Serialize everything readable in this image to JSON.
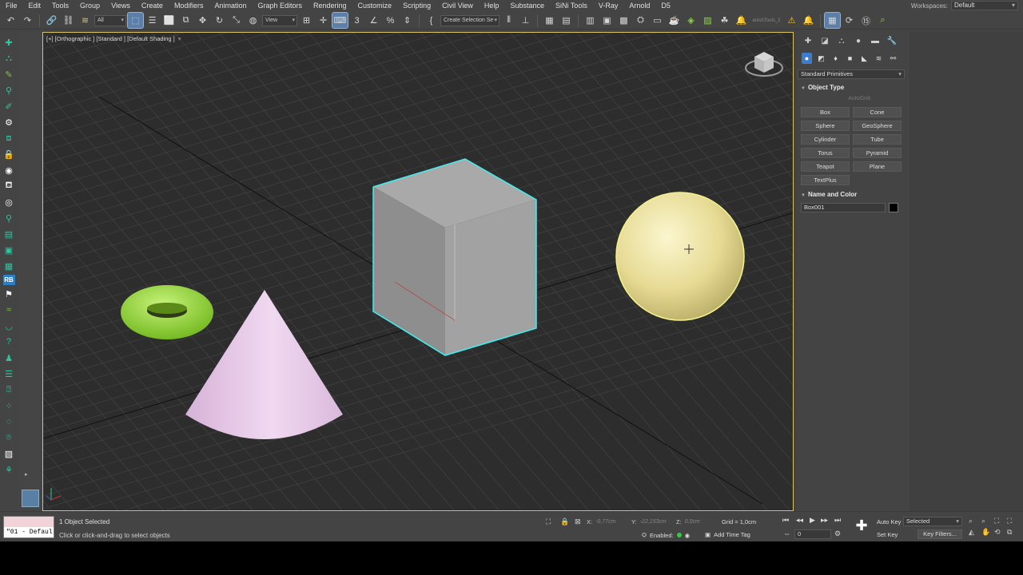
{
  "menubar": {
    "items": [
      "File",
      "Edit",
      "Tools",
      "Group",
      "Views",
      "Create",
      "Modifiers",
      "Animation",
      "Graph Editors",
      "Rendering",
      "Customize",
      "Scripting",
      "Civil View",
      "Help",
      "Substance",
      "SiNi Tools",
      "V-Ray",
      "Arnold",
      "D5"
    ],
    "workspaces_label": "Workspaces:",
    "workspaces_value": "Default"
  },
  "toolbar": {
    "filter_value": "All",
    "refcoord_value": "View",
    "selection_set_placeholder": "Create Selection Se",
    "sini_text": "anishTools_2"
  },
  "viewport": {
    "label": "[+] [Orthographic ] [Standard ] [Default Shading ]",
    "filter_icon": "funnel-icon",
    "colors": {
      "background": "#2d2d2d",
      "grid": "#404040",
      "selection": "#3ff0f0",
      "cube": "#9a9a9a",
      "sphere": "#e7dc96",
      "torus": "#8ddd2f",
      "cone": "#e8c6ea",
      "border_active": "#d9c36a"
    }
  },
  "command_panel": {
    "category_value": "Standard Primitives",
    "object_type_title": "Object Type",
    "autogrid_label": "AutoGrid",
    "object_buttons": [
      "Box",
      "Cone",
      "Sphere",
      "GeoSphere",
      "Cylinder",
      "Tube",
      "Torus",
      "Pyramid",
      "Teapot",
      "Plane",
      "TextPlus"
    ],
    "name_color_title": "Name and Color",
    "object_name": "Box001",
    "object_color": "#000000"
  },
  "statusbar": {
    "script_text": "\"01 - Defaul",
    "selection_status": "1 Object Selected",
    "prompt": "Click or click-and-drag to select objects",
    "x_label": "X:",
    "x_value": "-0,77cm",
    "y_label": "Y:",
    "y_value": "-22,153cm",
    "z_label": "Z:",
    "z_value": "0,0cm",
    "grid_text": "Grid = 1,0cm",
    "enabled_label": "Enabled:",
    "add_time_tag": "Add Time Tag",
    "frame_value": "0",
    "auto_key": "Auto Key",
    "set_key": "Set Key",
    "selected_value": "Selected",
    "key_filters": "Key Filters..."
  }
}
